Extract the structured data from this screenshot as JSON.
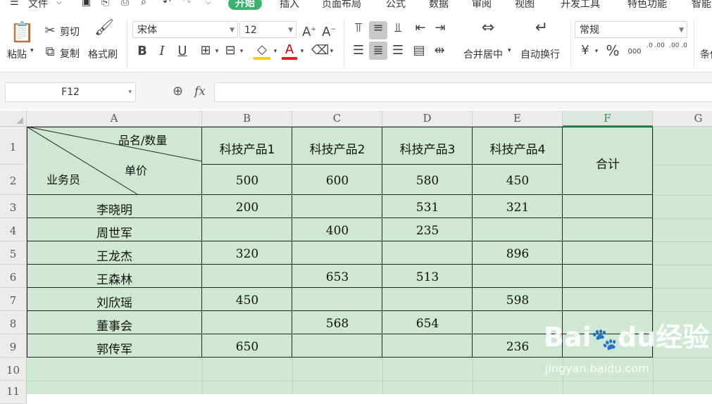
{
  "menu": {
    "file": "文件",
    "tabs": [
      "开始",
      "插入",
      "页面布局",
      "公式",
      "数据",
      "审阅",
      "视图",
      "开发工具",
      "特色功能",
      "智能"
    ]
  },
  "ribbon": {
    "paste": "粘贴",
    "cut": "剪切",
    "copy": "复制",
    "format_painter": "格式刷",
    "font_name": "宋体",
    "font_size": "12",
    "merge_center": "合并居中",
    "wrap_text": "自动换行",
    "number_format": "常规",
    "conditional": "条件",
    "bold": "B",
    "italic": "I",
    "underline": "U",
    "percent": "%",
    "thousands": "000",
    "increase_decimal": ".0 .00",
    "decrease_decimal": ".00 .0"
  },
  "formula_bar": {
    "name_box": "F12",
    "fx": "fx",
    "value": ""
  },
  "columns": [
    "A",
    "B",
    "C",
    "D",
    "E",
    "F",
    "G"
  ],
  "rows": [
    "1",
    "2",
    "3",
    "4",
    "5",
    "6",
    "7",
    "8",
    "9",
    "10",
    "11"
  ],
  "table": {
    "header_top": "品名/数量",
    "header_mid": "单价",
    "header_bottom": "业务员",
    "products": [
      "科技产品1",
      "科技产品2",
      "科技产品3",
      "科技产品4"
    ],
    "total_label": "合计",
    "prices": [
      "500",
      "600",
      "580",
      "450"
    ],
    "staff": [
      {
        "name": "李晓明",
        "q": [
          "200",
          "",
          "531",
          "321"
        ]
      },
      {
        "name": "周世军",
        "q": [
          "",
          "400",
          "235",
          ""
        ]
      },
      {
        "name": "王龙杰",
        "q": [
          "320",
          "",
          "",
          "896"
        ]
      },
      {
        "name": "王森林",
        "q": [
          "",
          "653",
          "513",
          ""
        ]
      },
      {
        "name": "刘欣瑶",
        "q": [
          "450",
          "",
          "",
          "598"
        ]
      },
      {
        "name": "董事会",
        "q": [
          "",
          "568",
          "654",
          ""
        ]
      },
      {
        "name": "郭传军",
        "q": [
          "650",
          "",
          "",
          "236"
        ]
      }
    ]
  },
  "watermark": {
    "brand": "Bai",
    "paw": "du",
    "product": "经验",
    "url": "jingyan.baidu.com"
  },
  "colors": {
    "accent": "#3bb36d",
    "sheet_bg": "#cfe8d3"
  }
}
